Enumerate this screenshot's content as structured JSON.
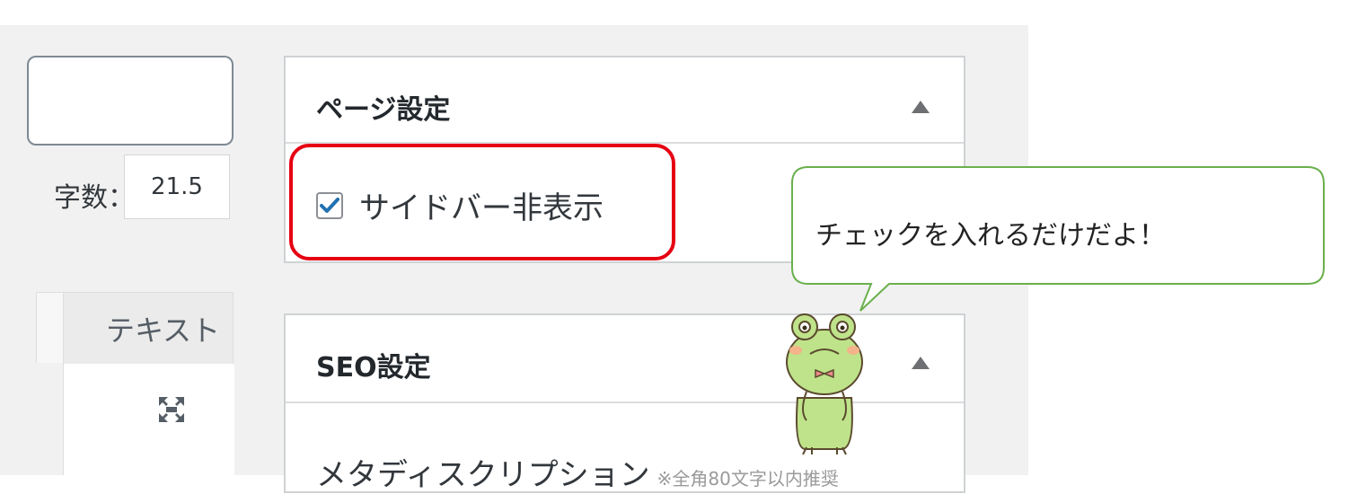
{
  "word_count": {
    "label_partial": "字数：",
    "value": "21.5"
  },
  "editor": {
    "tab_text": "テキスト"
  },
  "page_settings": {
    "title": "ページ設定",
    "hide_sidebar_label": "サイドバー非表示",
    "hide_sidebar_checked": true
  },
  "seo_settings": {
    "title": "SEO設定",
    "meta_description_label": "メタディスクリプション",
    "meta_description_note": "※全角80文字以内推奨"
  },
  "callout": {
    "text": "チェックを入れるだけだよ！"
  },
  "colors": {
    "highlight": "#e60012",
    "checkbox": "#2271b1",
    "bubble_border": "#6ab04c"
  }
}
